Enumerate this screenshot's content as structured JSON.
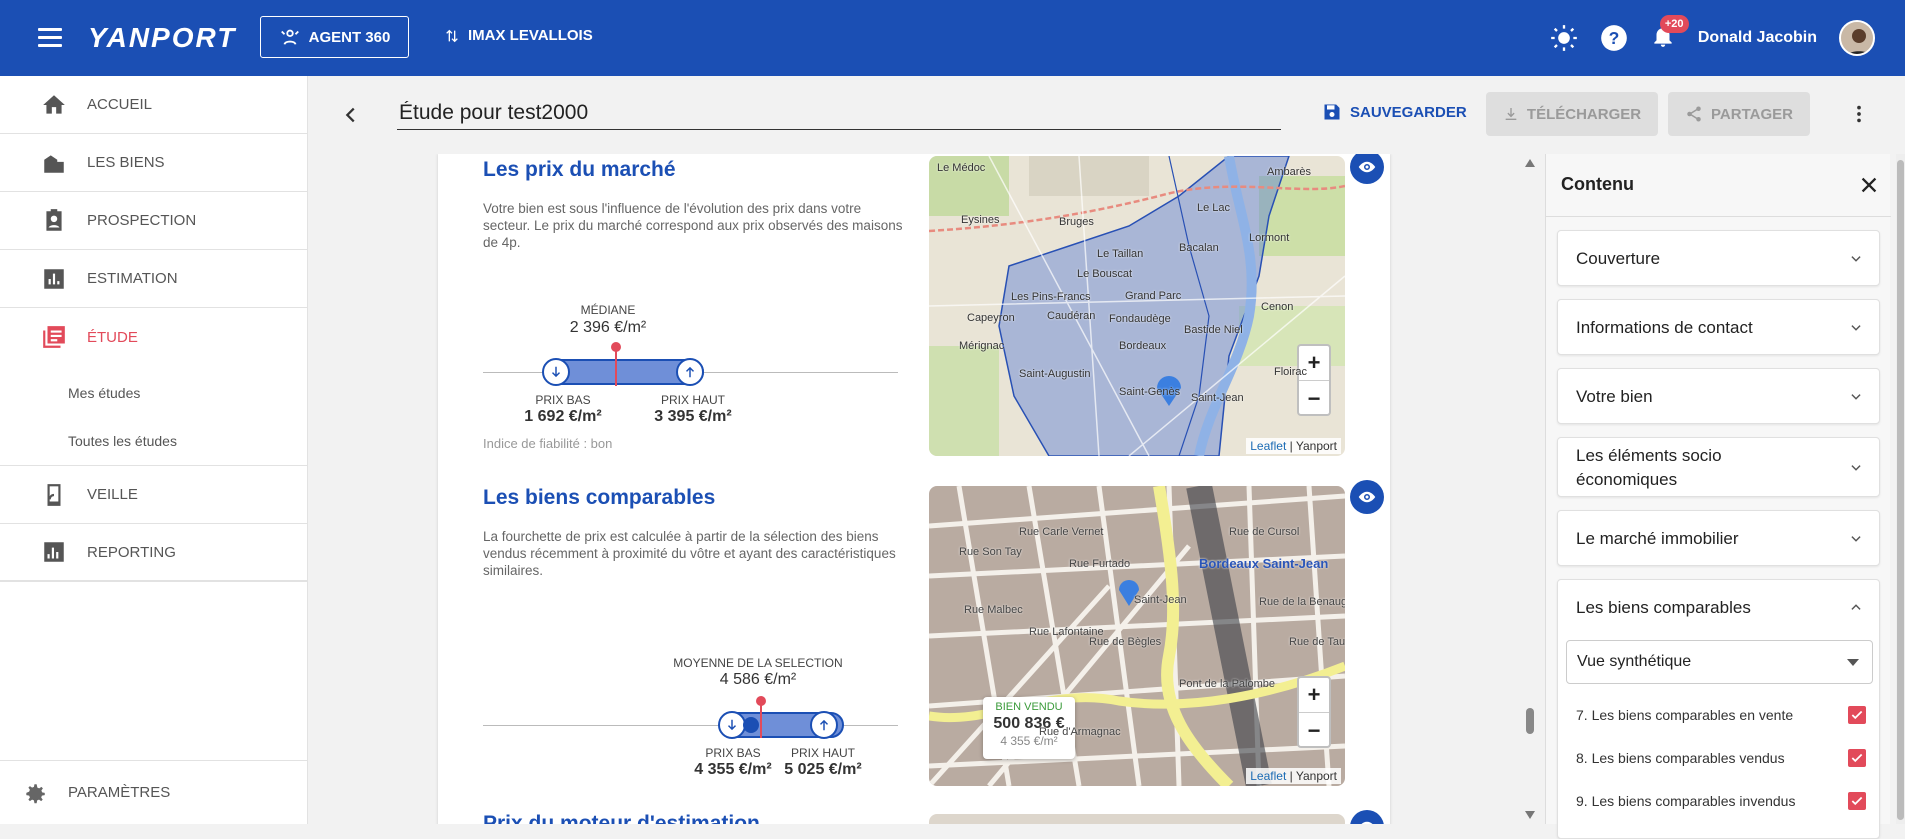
{
  "topbar": {
    "logo": "YANPORT",
    "agent_button": "AGENT 360",
    "agency": "IMAX LEVALLOIS",
    "notifications_badge": "+20",
    "user_name": "Donald Jacobin",
    "bar_color": "#1b4fb4"
  },
  "sidebar": {
    "items": [
      {
        "label": "ACCUEIL",
        "icon": "home-icon"
      },
      {
        "label": "LES BIENS",
        "icon": "buildings-icon"
      },
      {
        "label": "PROSPECTION",
        "icon": "contact-icon"
      },
      {
        "label": "ESTIMATION",
        "icon": "chart-icon"
      },
      {
        "label": "ÉTUDE",
        "icon": "study-icon"
      },
      {
        "label": "VEILLE",
        "icon": "watch-icon"
      },
      {
        "label": "REPORTING",
        "icon": "report-icon"
      }
    ],
    "sub_items": [
      "Mes études",
      "Toutes les études"
    ],
    "settings": "PARAMÈTRES",
    "active_color": "#e24a5a"
  },
  "header": {
    "title_value": "Étude pour test2000",
    "save": "SAUVEGARDER",
    "download": "TÉLÉCHARGER",
    "share": "PARTAGER"
  },
  "market": {
    "title": "Les prix du marché",
    "description": "Votre bien est sous l'influence de l'évolution des prix dans votre secteur. Le prix du marché correspond aux prix observés des maisons de 4p.",
    "median_label": "MÉDIANE",
    "median_value": "2 396 €/m²",
    "low_label": "PRIX BAS",
    "low_value": "1 692 €/m²",
    "high_label": "PRIX HAUT",
    "high_value": "3 395 €/m²",
    "reliability": "Indice de fiabilité : bon"
  },
  "map1": {
    "places": [
      "Le Médoc",
      "Ambarès",
      "Eysines",
      "Bruges",
      "Le Lac",
      "Bacalan",
      "Lormont",
      "Le Bouscat",
      "Mérignac",
      "Caudéran",
      "Bordeaux",
      "Bastide Niel",
      "Saint-Augustin",
      "Saint-Genès",
      "Cenon",
      "Le Taillan",
      "Grand Parc",
      "Fondaudège",
      "Capeyron",
      "Les Pins-Francs",
      "Saint-Jean",
      "Floirac"
    ],
    "attr_leaflet": "Leaflet",
    "attr_sep": " | ",
    "attr_brand": "Yanport"
  },
  "comparables": {
    "title": "Les biens comparables",
    "description": "La fourchette de prix est calculée à partir de la sélection des biens vendus récemment à proximité du vôtre et ayant des caractéristiques similaires.",
    "avg_label": "MOYENNE DE LA SELECTION",
    "avg_value": "4 586 €/m²",
    "low_label": "PRIX BAS",
    "low_value": "4 355 €/m²",
    "high_label": "PRIX HAUT",
    "high_value": "5 025 €/m²"
  },
  "map2": {
    "sold_label": "BIEN VENDU",
    "sold_price": "500 836 €",
    "sold_m2": "4 355 €/m²",
    "places": [
      "Bordeaux Saint-Jean",
      "Saint-Jean",
      "Pont de la Palombe",
      "Rue Malbec",
      "Rue Furtado",
      "Rue de Bègles",
      "Rue Son Tay",
      "Rue Lafontaine",
      "Rue Carle Vernet",
      "Rue de Cursol",
      "Rue de la Benauge",
      "Rue d'Armagnac",
      "Rue de Tauzia"
    ],
    "attr_leaflet": "Leaflet",
    "attr_sep": " | ",
    "attr_brand": "Yanport"
  },
  "next_section": {
    "title": "Prix du moteur d'estimation"
  },
  "panel": {
    "title": "Contenu",
    "accordions": [
      "Couverture",
      "Informations de contact",
      "Votre bien",
      "Les éléments socio économiques",
      "Le marché immobilier",
      "Les biens comparables"
    ],
    "view_select": "Vue synthétique",
    "checks": [
      "7. Les biens comparables en vente",
      "8. Les biens comparables vendus",
      "9. Les biens comparables invendus"
    ]
  }
}
